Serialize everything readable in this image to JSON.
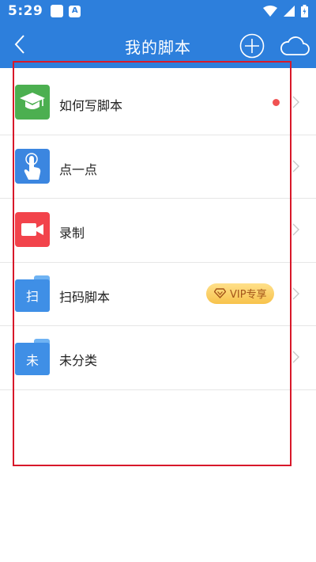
{
  "status_bar": {
    "time": "5:29"
  },
  "header": {
    "title": "我的脚本"
  },
  "items": [
    {
      "label": "如何写脚本"
    },
    {
      "label": "点一点"
    },
    {
      "label": "录制"
    },
    {
      "label": "扫码脚本",
      "folder_glyph": "扫",
      "badge": "VIP专享"
    },
    {
      "label": "未分类",
      "folder_glyph": "未"
    }
  ],
  "colors": {
    "header_bg": "#2d7fdc",
    "how_to_icon": "#4caf50",
    "tap_icon": "#3b86e0",
    "record_icon": "#f2434b",
    "folder": "#3f8fe6",
    "dot": "#f05252",
    "highlight_border": "#d8182a"
  }
}
